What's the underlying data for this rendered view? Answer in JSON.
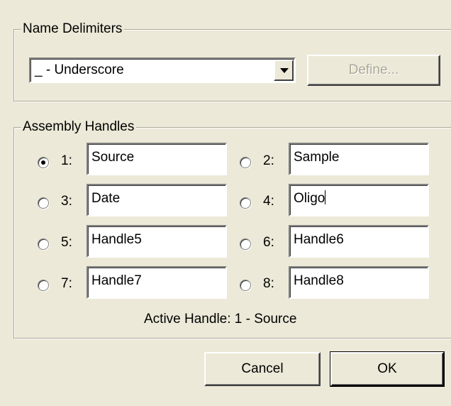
{
  "name_delimiters": {
    "title": "Name Delimiters",
    "combo_value": "_ - Underscore",
    "define_label": "Define..."
  },
  "assembly_handles": {
    "title": "Assembly Handles",
    "selected": 1,
    "handles": [
      {
        "label": "1:",
        "value": "Source",
        "checked": true
      },
      {
        "label": "2:",
        "value": "Sample",
        "checked": false
      },
      {
        "label": "3:",
        "value": "Date",
        "checked": false
      },
      {
        "label": "4:",
        "value": "Oligo",
        "checked": false
      },
      {
        "label": "5:",
        "value": "Handle5",
        "checked": false
      },
      {
        "label": "6:",
        "value": "Handle6",
        "checked": false
      },
      {
        "label": "7:",
        "value": "Handle7",
        "checked": false
      },
      {
        "label": "8:",
        "value": "Handle8",
        "checked": false
      }
    ],
    "active_handle_text": "Active Handle: 1 - Source"
  },
  "buttons": {
    "cancel_label": "Cancel",
    "ok_label": "OK"
  }
}
